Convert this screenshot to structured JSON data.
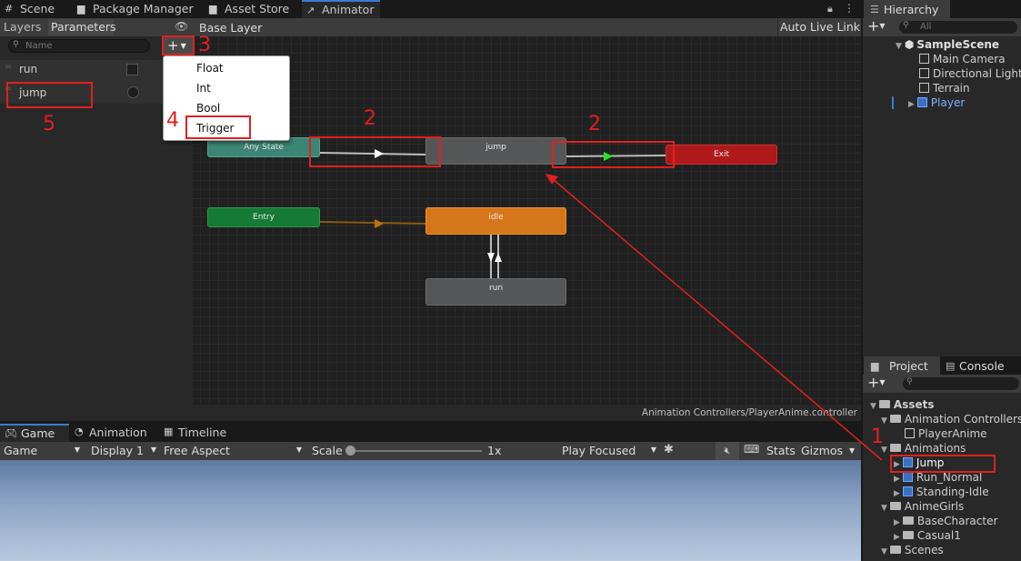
{
  "tabs_main": [
    {
      "label": "Scene",
      "icon": "grid-icon"
    },
    {
      "label": "Package Manager",
      "icon": "package-icon"
    },
    {
      "label": "Asset Store",
      "icon": "store-icon"
    },
    {
      "label": "Animator",
      "icon": "animator-icon"
    }
  ],
  "hierarchy": {
    "tab": "Hierarchy",
    "search_placeholder": "All",
    "scene": "SampleScene",
    "items": [
      "Main Camera",
      "Directional Light",
      "Terrain",
      "Player"
    ]
  },
  "animator": {
    "left_tabs": [
      "Layers",
      "Parameters"
    ],
    "search_placeholder": "Name",
    "params": [
      {
        "name": "run"
      },
      {
        "name": "jump"
      }
    ],
    "dropdown": [
      "Float",
      "Int",
      "Bool",
      "Trigger"
    ],
    "breadcrumb": "Base Layer",
    "auto_live_link": "Auto Live Link",
    "nodes": {
      "any_state": "Any State",
      "jump": "jump",
      "exit": "Exit",
      "entry": "Entry",
      "idle": "idle",
      "run": "run"
    },
    "footer_path": "Animation Controllers/PlayerAnime.controller"
  },
  "bottom": {
    "tabs": [
      "Game",
      "Animation",
      "Timeline"
    ],
    "game_dropdown": "Game",
    "display_dropdown": "Display 1",
    "aspect_dropdown": "Free Aspect",
    "scale_label": "Scale",
    "scale_value": "1x",
    "play_focused": "Play Focused",
    "stats": "Stats",
    "gizmos": "Gizmos"
  },
  "project": {
    "tabs": [
      "Project",
      "Console"
    ],
    "tree": [
      {
        "label": "Assets",
        "indent": 0,
        "type": "folder-open",
        "bold": true
      },
      {
        "label": "Animation Controllers",
        "indent": 1,
        "type": "folder-open"
      },
      {
        "label": "PlayerAnime",
        "indent": 2,
        "type": "controller"
      },
      {
        "label": "Animations",
        "indent": 1,
        "type": "folder-open"
      },
      {
        "label": "Jump",
        "indent": 2,
        "type": "clip",
        "selected": true
      },
      {
        "label": "Run_Normal",
        "indent": 2,
        "type": "clip"
      },
      {
        "label": "Standing-Idle",
        "indent": 2,
        "type": "clip"
      },
      {
        "label": "AnimeGirls",
        "indent": 1,
        "type": "folder-open"
      },
      {
        "label": "BaseCharacter",
        "indent": 2,
        "type": "folder"
      },
      {
        "label": "Casual1",
        "indent": 2,
        "type": "folder"
      },
      {
        "label": "Scenes",
        "indent": 1,
        "type": "folder-open"
      }
    ]
  },
  "annotations": {
    "n1": "1",
    "n2a": "2",
    "n2b": "2",
    "n3": "3",
    "n4": "4",
    "n5": "5"
  }
}
